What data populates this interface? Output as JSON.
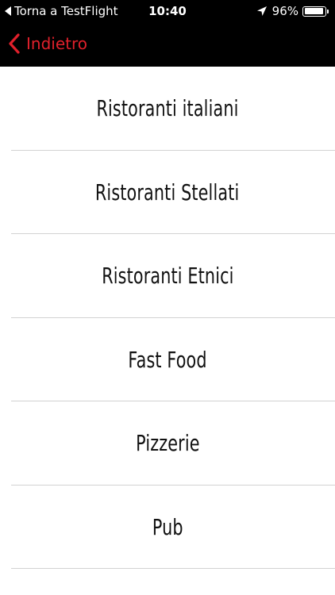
{
  "status_bar": {
    "back_app_label": "Torna a TestFlight",
    "time": "10:40",
    "battery_percent_label": "96%",
    "battery_level": 0.96,
    "icons": [
      "back-arrow-icon",
      "location-arrow-icon",
      "battery-icon"
    ]
  },
  "nav_bar": {
    "back_label": "Indietro",
    "accent_color": "#e0202b"
  },
  "categories": [
    {
      "label": "Ristoranti italiani"
    },
    {
      "label": "Ristoranti Stellati"
    },
    {
      "label": "Ristoranti Etnici"
    },
    {
      "label": "Fast Food"
    },
    {
      "label": "Pizzerie"
    },
    {
      "label": "Pub"
    }
  ]
}
